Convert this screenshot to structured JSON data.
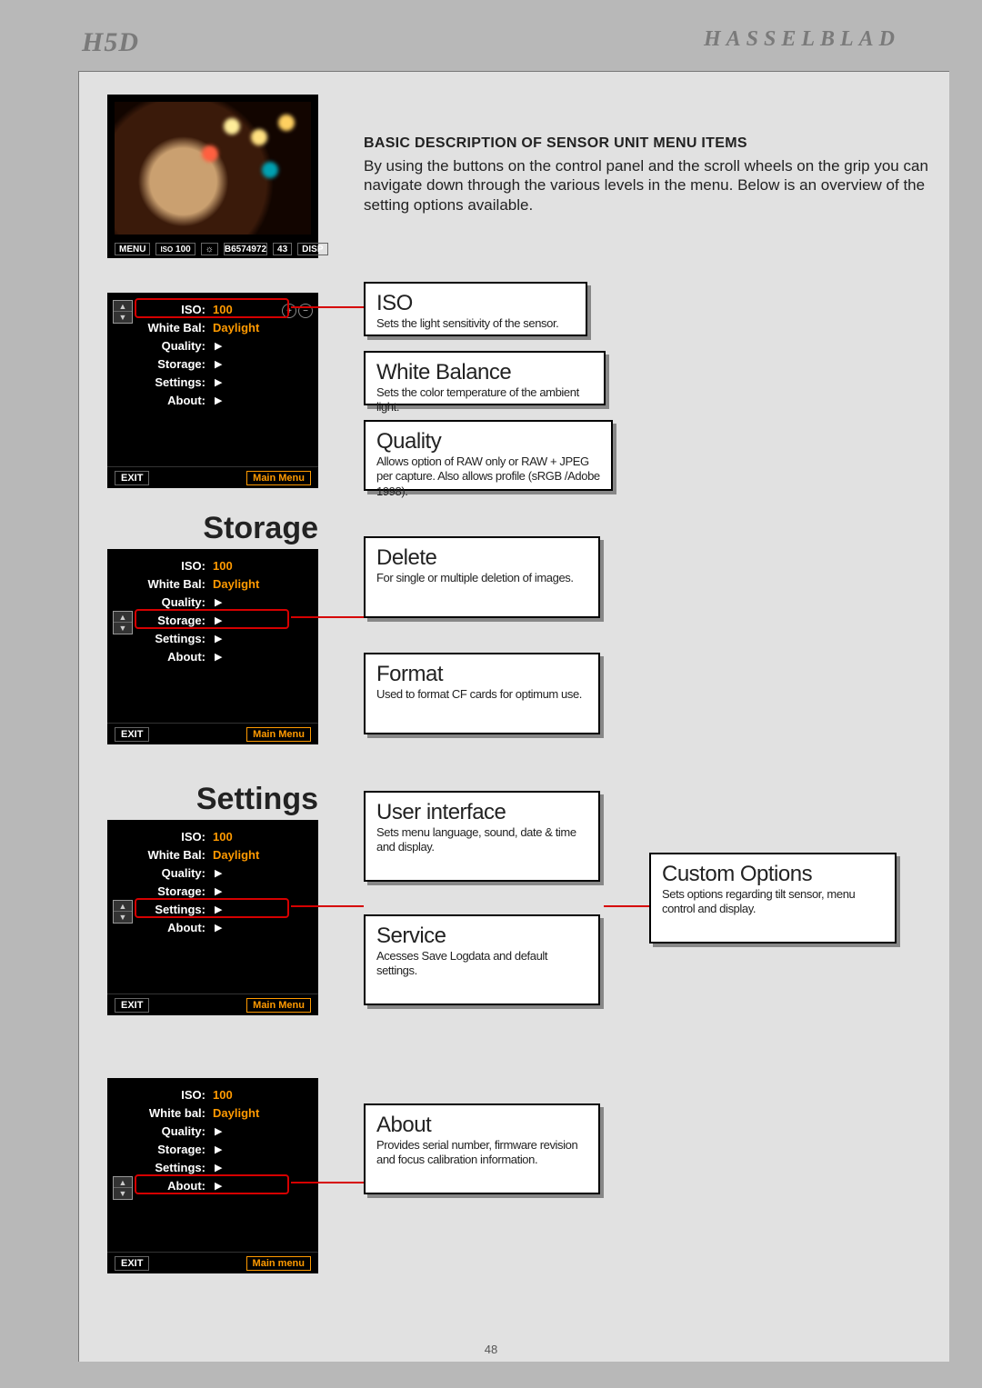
{
  "header": {
    "left": "H5D",
    "right": "HASSELBLAD"
  },
  "page_number": "48",
  "intro": {
    "title": "Basic Description Of Sensor Unit Menu Items",
    "body": "By using the buttons on the control panel and the scroll wheels on the grip you can navigate down through the various levels in the menu. Below is an overview of the setting options available."
  },
  "preview_bar": {
    "menu": "MENU",
    "iso_label": "ISO",
    "iso_value": "100",
    "sun": "☼",
    "serial": "B6574972",
    "count": "43",
    "disp": "DISP"
  },
  "menus": {
    "labels": {
      "iso": "ISO:",
      "white_bal": "White Bal:",
      "white_bal_alt": "White bal:",
      "quality": "Quality:",
      "storage": "Storage:",
      "settings": "Settings:",
      "about": "About:"
    },
    "values": {
      "iso": "100",
      "wb": "Daylight"
    },
    "exit": "EXIT",
    "main_menu": "Main Menu",
    "main_menu_alt": "Main menu"
  },
  "sections": {
    "storage": "Storage",
    "settings": "Settings"
  },
  "info": {
    "iso": {
      "title": "ISO",
      "desc": "Sets the light sensitivity of the sensor."
    },
    "wb": {
      "title": "White Balance",
      "desc": "Sets the color temperature of the ambient light."
    },
    "quality": {
      "title": "Quality",
      "desc": "Allows option of RAW only or RAW + JPEG per capture. Also allows profile (sRGB /Adobe 1998)."
    },
    "delete": {
      "title": "Delete",
      "desc": "For single or multiple deletion of images."
    },
    "format": {
      "title": "Format",
      "desc": "Used to format CF cards for optimum use."
    },
    "ui": {
      "title": "User interface",
      "desc": "Sets menu language, sound, date & time and display."
    },
    "custom": {
      "title": "Custom Options",
      "desc": "Sets options regarding tilt sensor, menu control and display."
    },
    "service": {
      "title": "Service",
      "desc": "Acesses Save Logdata and default settings."
    },
    "about": {
      "title": "About",
      "desc": "Provides serial number, firmware revision and focus calibration information."
    }
  }
}
